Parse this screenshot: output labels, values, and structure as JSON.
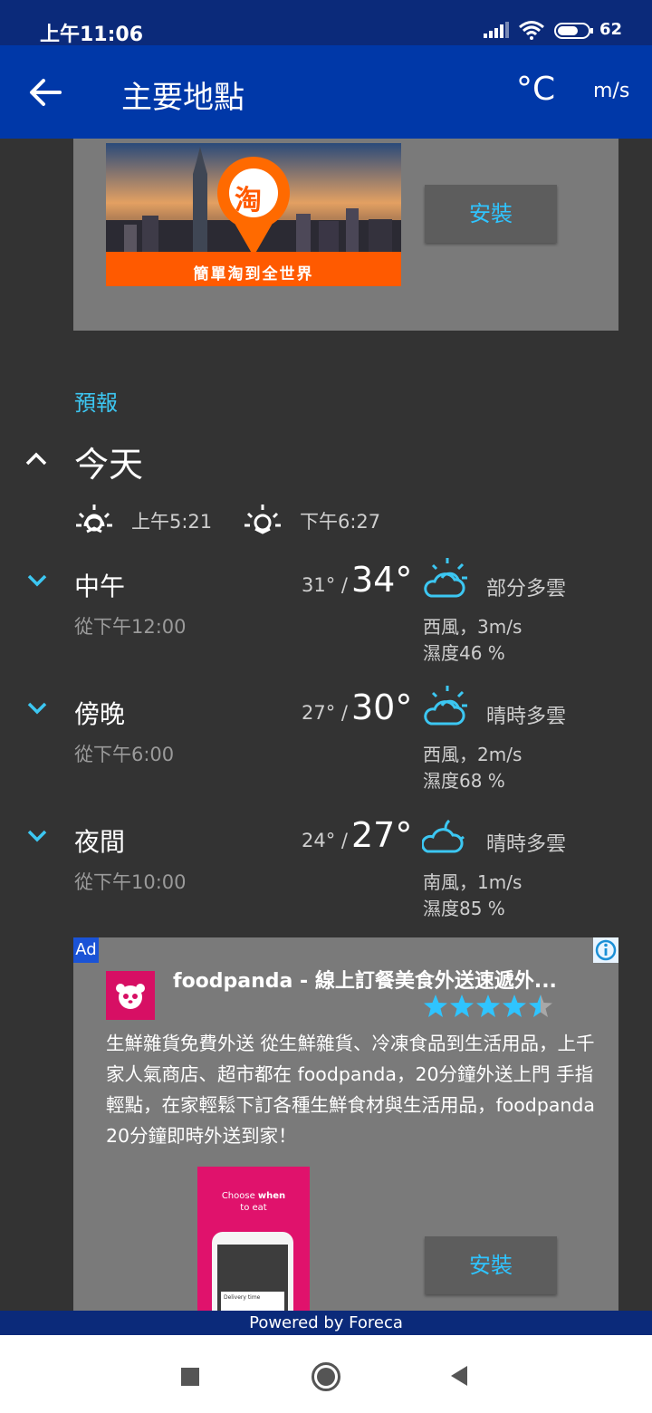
{
  "status_bar": {
    "time": "上午11:06",
    "battery": "62"
  },
  "app_bar": {
    "title": "主要地點",
    "temp_unit": "°C",
    "wind_unit": "m/s"
  },
  "ad_top": {
    "image_text": "簡單淘到全世界",
    "logo_char": "淘",
    "install_label": "安裝"
  },
  "forecast": {
    "section_label": "預報",
    "day_title": "今天",
    "sunrise": "上午5:21",
    "sunset": "下午6:27",
    "periods": [
      {
        "name": "中午",
        "from": "從下午12:00",
        "low": "31° /",
        "high": "34°",
        "condition": "部分多雲",
        "wind": "西風，3m/s",
        "humidity": "濕度46 %",
        "icon": "partly-cloudy-sun-icon"
      },
      {
        "name": "傍晚",
        "from": "從下午6:00",
        "low": "27° /",
        "high": "30°",
        "condition": "晴時多雲",
        "wind": "西風，2m/s",
        "humidity": "濕度68 %",
        "icon": "partly-cloudy-sun-icon"
      },
      {
        "name": "夜間",
        "from": "從下午10:00",
        "low": "24° /",
        "high": "27°",
        "condition": "晴時多雲",
        "wind": "南風，1m/s",
        "humidity": "濕度85 %",
        "icon": "partly-cloudy-night-icon"
      }
    ]
  },
  "ad_bottom": {
    "badge": "Ad",
    "headline": "foodpanda - 線上訂餐美食外送速遞外...",
    "rating": 4.5,
    "body": "生鮮雜貨免費外送 從生鮮雜貨、冷凍食品到生活用品，上千家人氣商店、超市都在 foodpanda，20分鐘外送上門 手指輕點，在家輕鬆下訂各種生鮮食材與生活用品，foodpanda 20分鐘即時外送到家！",
    "screenshot_text_1": "Choose ",
    "screenshot_text_bold": "when",
    "screenshot_text_2": "to eat",
    "screenshot_card": "Delivery time",
    "install_label": "安裝"
  },
  "footer": {
    "powered_by": "Powered by Foreca"
  },
  "colors": {
    "status_bar": "#0b2a7a",
    "app_bar": "#0038a8",
    "accent": "#3cc7f2",
    "background": "#333333",
    "ad_bg": "#7a7a7a",
    "foodpanda": "#d70f64"
  }
}
